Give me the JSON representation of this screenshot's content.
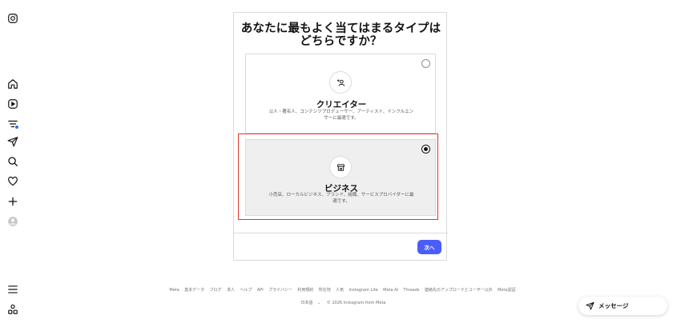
{
  "sidebar": {
    "icons": [
      "instagram-logo-icon",
      "home-icon",
      "reels-icon",
      "filter-icon",
      "paper-plane-icon",
      "search-icon",
      "heart-icon",
      "plus-icon",
      "profile-icon",
      "menu-icon",
      "more-apps-icon"
    ]
  },
  "card": {
    "title_line1": "あなたに最もよく当てはまるタイプは",
    "title_line2": "どちらですか？",
    "options": [
      {
        "title": "クリエイター",
        "desc_line1": "公人・著名人、コンテンツプロデューサー、アーティスト、インフルエン",
        "desc_line2": "サーに最適です。",
        "selected": false,
        "icon": "creator-icon"
      },
      {
        "title": "ビジネス",
        "desc_line1": "小売店、ローカルビジネス、ブランド、組織、サービスプロバイダーに最",
        "desc_line2": "適です。",
        "selected": true,
        "icon": "storefront-icon"
      }
    ],
    "next_label": "次へ"
  },
  "footer": {
    "links": [
      "Meta",
      "基本データ",
      "ブログ",
      "求人",
      "ヘルプ",
      "API",
      "プライバシー",
      "利用規約",
      "所在地",
      "人気",
      "Instagram Lite",
      "Meta AI",
      "Threads",
      "連絡先のアップロードとユーザー以外",
      "Meta認証"
    ],
    "language": "日本語",
    "copyright": "© 2026 Instagram from Meta"
  },
  "messages": {
    "label": "メッセージ"
  }
}
